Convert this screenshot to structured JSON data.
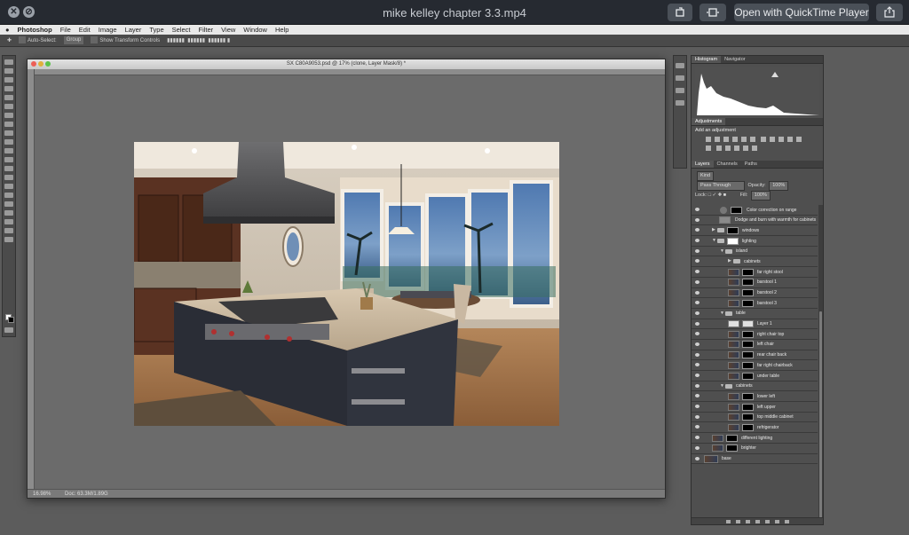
{
  "player": {
    "title": "mike kelley chapter 3.3.mp4",
    "close_symbol": "✕",
    "fullscreen_symbol": "⊘",
    "open_with_label": "Open with QuickTime Player"
  },
  "menubar": {
    "app": "Photoshop",
    "items": [
      "File",
      "Edit",
      "Image",
      "Layer",
      "Type",
      "Select",
      "Filter",
      "View",
      "Window",
      "Help"
    ]
  },
  "options": {
    "auto_select": "Auto-Select:",
    "group": "Group",
    "transform_controls": "Show Transform Controls"
  },
  "document": {
    "title": "SX C80A9053.psd @ 17% (clone, Layer Mask/8) *",
    "zoom": "16.98%",
    "doc_size": "Doc: 63.3M/1.89G"
  },
  "panels": {
    "histogram_tab": "Histogram",
    "navigator_tab": "Navigator",
    "adjustments_tab": "Adjustments",
    "add_adjustment": "Add an adjustment",
    "layers_tab": "Layers",
    "channels_tab": "Channels",
    "paths_tab": "Paths",
    "kind": "Kind",
    "blend_mode": "Pass Through",
    "opacity_label": "Opacity:",
    "opacity_value": "100%",
    "lock_label": "Lock:",
    "fill_label": "Fill:",
    "fill_value": "100%"
  },
  "layers": [
    {
      "name": "Color correction on range",
      "indent": 2,
      "type": "adj"
    },
    {
      "name": "Dodge and burn with warmth for cabinets",
      "indent": 1,
      "type": "gray"
    },
    {
      "name": "windows",
      "indent": 1,
      "type": "group",
      "collapsed": true
    },
    {
      "name": "lighting",
      "indent": 1,
      "type": "group"
    },
    {
      "name": "island",
      "indent": 2,
      "type": "folder"
    },
    {
      "name": "cabinets",
      "indent": 3,
      "type": "folder",
      "collapsed": true
    },
    {
      "name": "far right stool",
      "indent": 3,
      "type": "layer"
    },
    {
      "name": "barstool 1",
      "indent": 3,
      "type": "layer"
    },
    {
      "name": "barstool 2",
      "indent": 3,
      "type": "layer"
    },
    {
      "name": "barstool 3",
      "indent": 3,
      "type": "layer"
    },
    {
      "name": "table",
      "indent": 2,
      "type": "folder"
    },
    {
      "name": "Layer 1",
      "indent": 3,
      "type": "white"
    },
    {
      "name": "right chair top",
      "indent": 3,
      "type": "layer"
    },
    {
      "name": "left chair",
      "indent": 3,
      "type": "layer"
    },
    {
      "name": "rear chair back",
      "indent": 3,
      "type": "layer"
    },
    {
      "name": "far right chairback",
      "indent": 3,
      "type": "layer"
    },
    {
      "name": "under table",
      "indent": 3,
      "type": "layer"
    },
    {
      "name": "cabinets",
      "indent": 2,
      "type": "folder"
    },
    {
      "name": "lower left",
      "indent": 3,
      "type": "layer"
    },
    {
      "name": "left upper",
      "indent": 3,
      "type": "layer"
    },
    {
      "name": "top middle cabinet",
      "indent": 3,
      "type": "layer"
    },
    {
      "name": "refrigerator",
      "indent": 3,
      "type": "layer"
    },
    {
      "name": "different lighting",
      "indent": 1,
      "type": "layer"
    },
    {
      "name": "brighter",
      "indent": 1,
      "type": "layer"
    },
    {
      "name": "base",
      "indent": 0,
      "type": "base"
    }
  ]
}
